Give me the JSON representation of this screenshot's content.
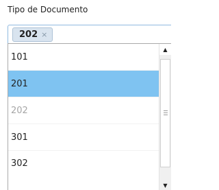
{
  "field": {
    "label": "Tipo de Documento",
    "selected_tags": [
      {
        "text": "202",
        "remove_icon": "×"
      }
    ]
  },
  "dropdown": {
    "options": [
      {
        "label": "101",
        "state": "normal"
      },
      {
        "label": "201",
        "state": "highlighted"
      },
      {
        "label": "202",
        "state": "disabled"
      },
      {
        "label": "301",
        "state": "normal"
      },
      {
        "label": "302",
        "state": "normal"
      }
    ],
    "scrollbar": {
      "up_icon": "▲",
      "down_icon": "▼"
    }
  },
  "colors": {
    "highlight": "#7fc3f1",
    "chip_background": "#d9e4ef",
    "disabled_text": "#a6a6a6",
    "focus_border": "#8fb9e0"
  }
}
